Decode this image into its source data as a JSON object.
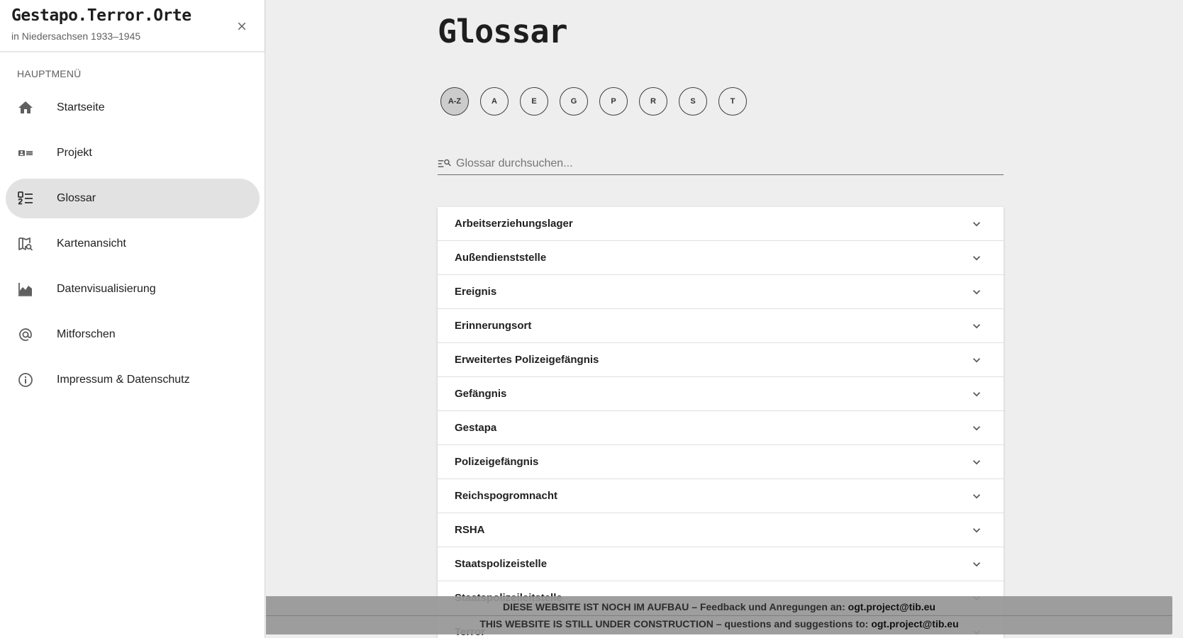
{
  "sidebar": {
    "brand": "Gestapo.Terror.Orte",
    "subtitle": "in Niedersachsen 1933–1945",
    "section_label": "HAUPTMENÜ",
    "items": [
      {
        "label": "Startseite",
        "icon": "home-icon"
      },
      {
        "label": "Projekt",
        "icon": "id-card-icon"
      },
      {
        "label": "Glossar",
        "icon": "numbered-list-icon",
        "active": true
      },
      {
        "label": "Kartenansicht",
        "icon": "map-search-icon"
      },
      {
        "label": "Datenvisualisierung",
        "icon": "area-chart-icon"
      },
      {
        "label": "Mitforschen",
        "icon": "at-sign-icon"
      },
      {
        "label": "Impressum & Datenschutz",
        "icon": "info-icon"
      }
    ]
  },
  "main": {
    "title": "Glossar",
    "letters": [
      "A-Z",
      "A",
      "E",
      "G",
      "P",
      "R",
      "S",
      "T"
    ],
    "active_letter": "A-Z",
    "search_placeholder": "Glossar durchsuchen...",
    "entries": [
      "Arbeitserziehungslager",
      "Außendienststelle",
      "Ereignis",
      "Erinnerungsort",
      "Erweitertes Polizeigefängnis",
      "Gefängnis",
      "Gestapa",
      "Polizeigefängnis",
      "Reichspogromnacht",
      "RSHA",
      "Staatspolizeistelle",
      "Staatspolizeileitstelle",
      "Terror"
    ]
  },
  "banner": {
    "line1_text": "DIESE WEBSITE IST NOCH IM AUFBAU – Feedback und Anregungen an: ",
    "line1_email": "ogt.project@tib.eu",
    "line2_text": "THIS WEBSITE IS STILL UNDER CONSTRUCTION – questions and suggestions to: ",
    "line2_email": "ogt.project@tib.eu"
  },
  "colors": {
    "background": "#eeeeee",
    "active_nav": "#e2e2e2",
    "active_letter": "#cccccc",
    "banner": "#969696"
  }
}
